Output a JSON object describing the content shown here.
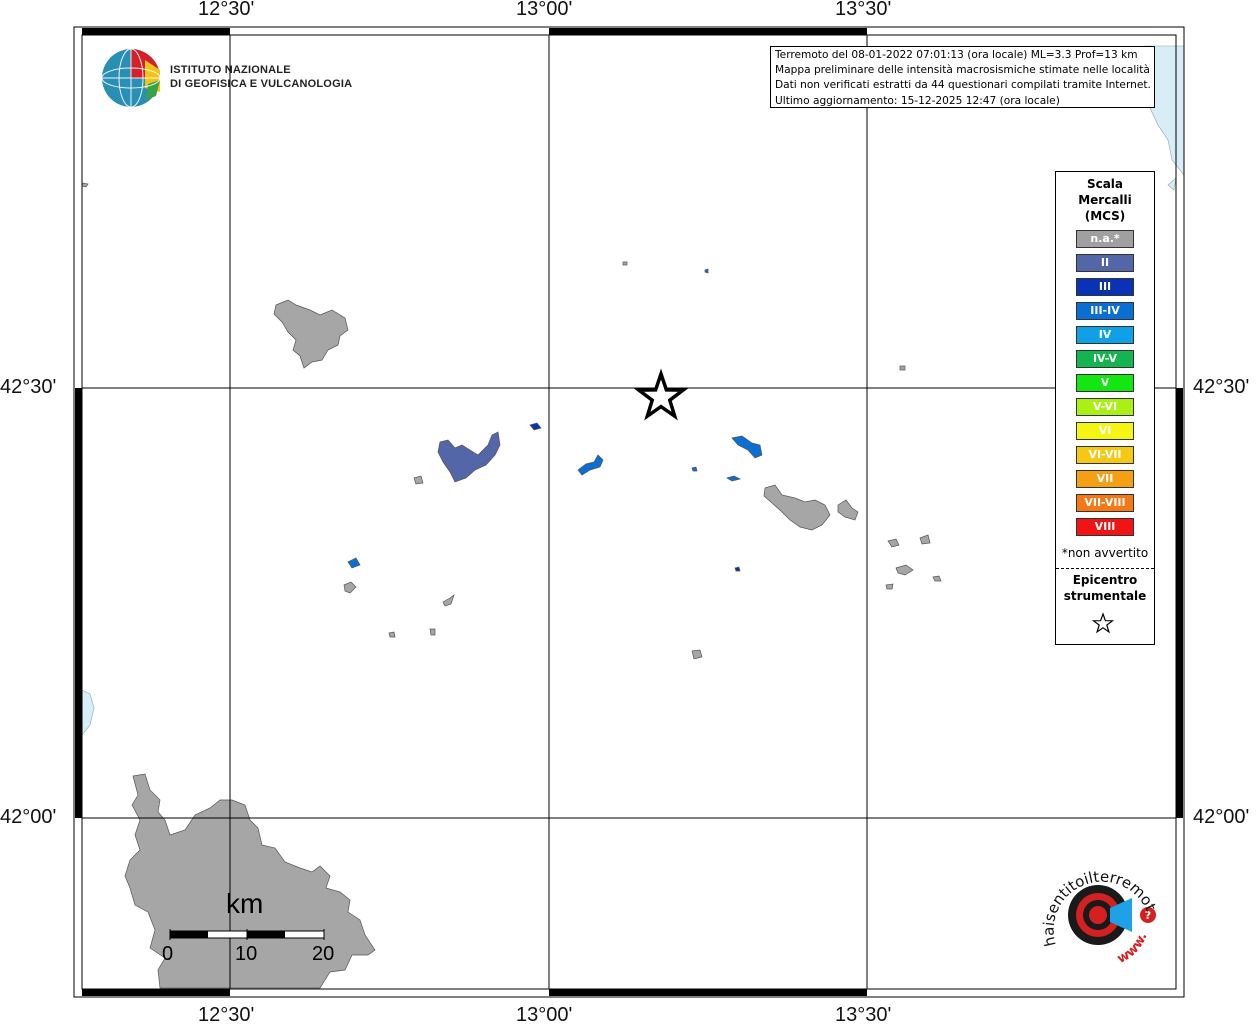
{
  "map": {
    "grid_labels": {
      "top": [
        "12°30'",
        "13°00'",
        "13°30'"
      ],
      "bottom": [
        "12°30'",
        "13°00'",
        "13°30'"
      ],
      "left": [
        "42°30'",
        "42°00'"
      ],
      "right": [
        "42°30'",
        "42°00'"
      ]
    },
    "land_color": "#a6a6a6",
    "water_color": "#d9edf7",
    "epicenter_symbol": "star-icon"
  },
  "institute_logo": {
    "line1": "ISTITUTO NAZIONALE",
    "line2": "DI GEOFISICA E VULCANOLOGIA"
  },
  "info": {
    "line1": "Terremoto del 08-01-2022 07:01:13 (ora locale) ML=3.3 Prof=13 km",
    "line2": "Mappa preliminare delle intensità macrosismiche stimate nelle località",
    "line3": "Dati non verificati estratti da 44 questionari compilati tramite Internet.",
    "line4": "Ultimo aggiornamento: 15-12-2025 12:47 (ora locale)"
  },
  "legend": {
    "title_line1": "Scala",
    "title_line2": "Mercalli",
    "title_line3": "(MCS)",
    "items": [
      {
        "label": "n.a.*",
        "color": "#a0a0a0"
      },
      {
        "label": "II",
        "color": "#5366a8"
      },
      {
        "label": "III",
        "color": "#0a32b4"
      },
      {
        "label": "III-IV",
        "color": "#0a6ed2"
      },
      {
        "label": "IV",
        "color": "#10a0e6"
      },
      {
        "label": "IV-V",
        "color": "#14b450"
      },
      {
        "label": "V",
        "color": "#14e614"
      },
      {
        "label": "V-VI",
        "color": "#aaf014"
      },
      {
        "label": "VI",
        "color": "#f5f514"
      },
      {
        "label": "VI-VII",
        "color": "#f5c814"
      },
      {
        "label": "VII",
        "color": "#f5a014"
      },
      {
        "label": "VII-VIII",
        "color": "#f57814"
      },
      {
        "label": "VIII",
        "color": "#f01414"
      }
    ],
    "note": "*non avvertito",
    "epicenter_line1": "Epicentro",
    "epicenter_line2": "strumentale"
  },
  "scale_bar": {
    "unit": "km",
    "labels": [
      "0",
      "10",
      "20"
    ]
  },
  "haisentito_logo": {
    "text": "haisentitoilterremoto.it",
    "url_text": "www."
  }
}
